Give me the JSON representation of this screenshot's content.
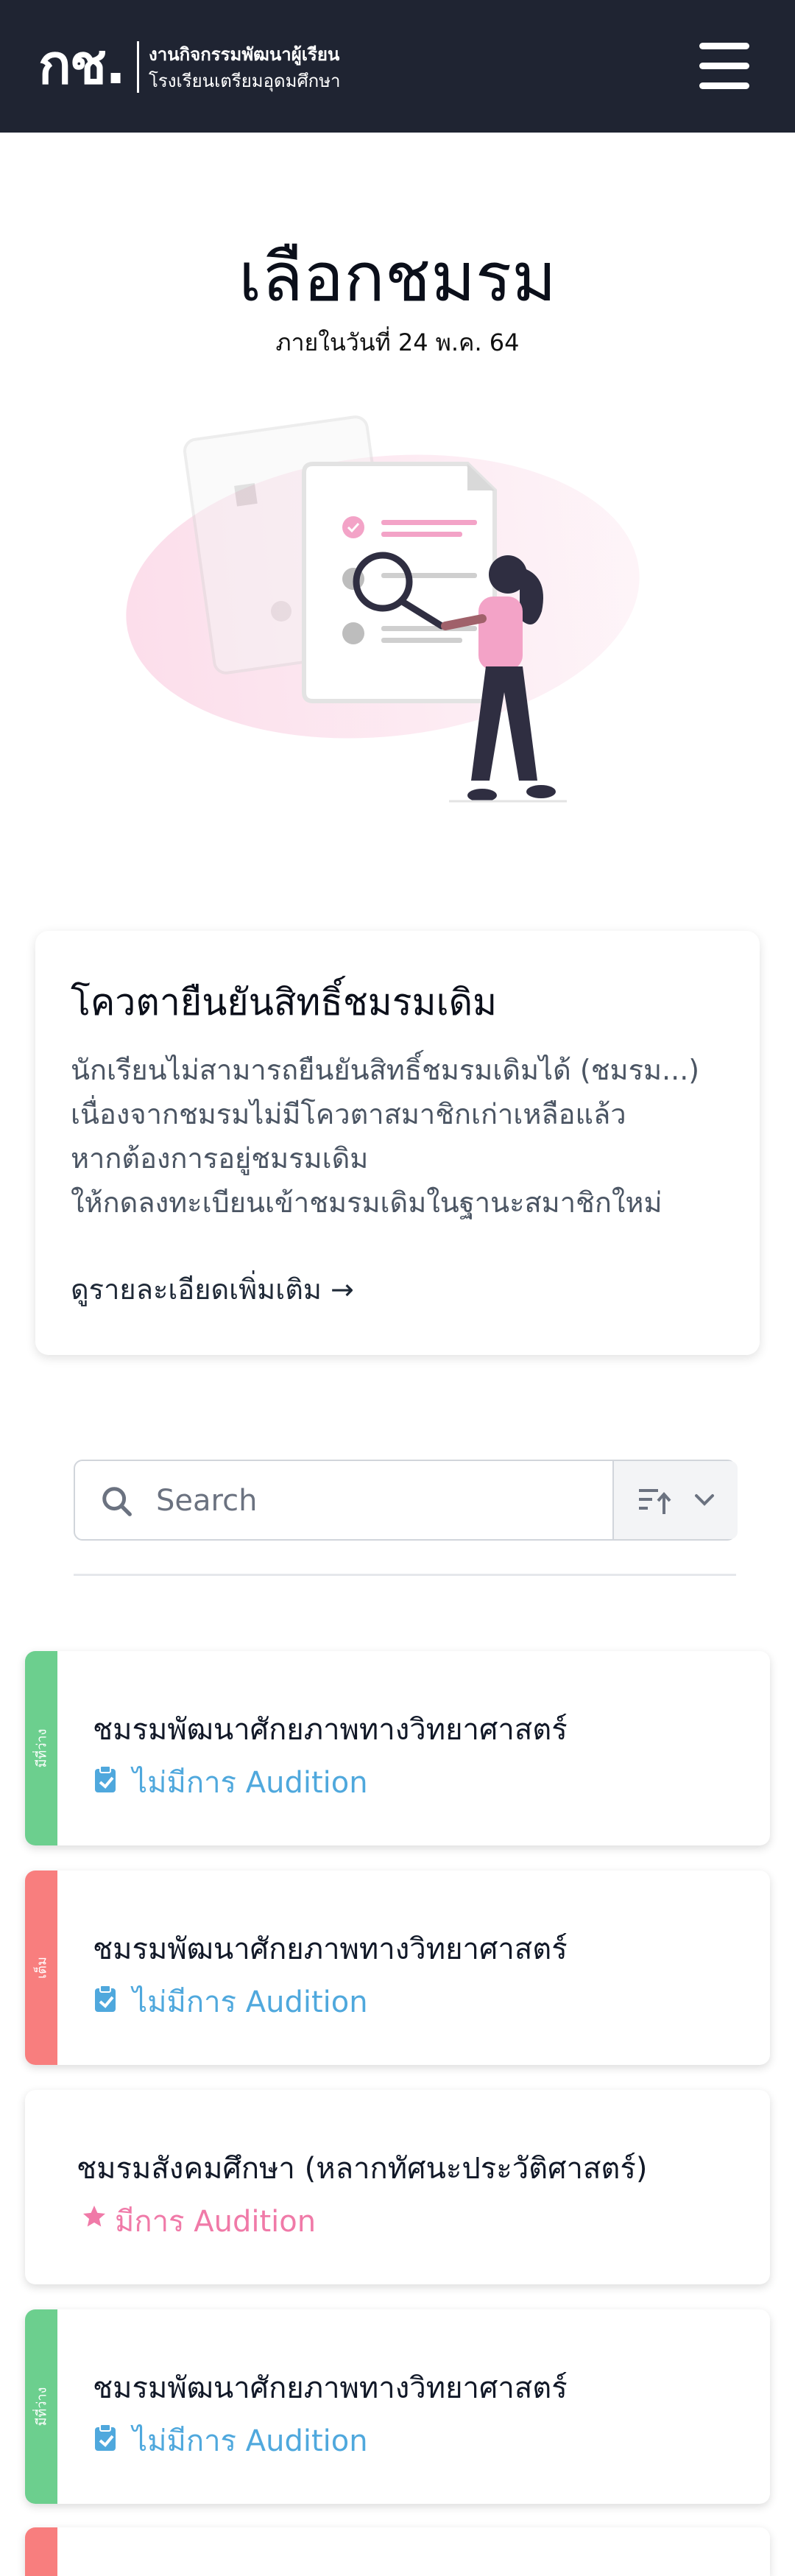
{
  "header": {
    "logo_mark": "กช.",
    "logo_line1": "งานกิจกรรมพัฒนาผู้เรียน",
    "logo_line2": "โรงเรียนเตรียมอุดมศึกษา"
  },
  "page": {
    "title": "เลือกชมรม",
    "subtitle": "ภายในวันที่ 24 พ.ค. 64"
  },
  "quota_card": {
    "title": "โควตายืนยันสิทธิ์ชมรมเดิม",
    "lines": [
      "นักเรียนไม่สามารถยืนยันสิทธิ์ชมรมเดิมได้ (ชมรม...)",
      "เนื่องจากชมรมไม่มีโควตาสมาชิกเก่าเหลือแล้ว",
      "หากต้องการอยู่ชมรมเดิม",
      "ให้กดลงทะเบียนเข้าชมรมเดิมในฐานะสมาชิกใหม่"
    ],
    "more_link": "ดูรายละเอียดเพิ่มเติม →"
  },
  "search": {
    "placeholder": "Search",
    "value": ""
  },
  "colors": {
    "header_bg": "#1f2432",
    "available": "#6ccf8e",
    "full": "#f87e7e",
    "no_audition": "#4fa8dd",
    "audition": "#f07aa8"
  },
  "clubs": [
    {
      "status": "มีที่ว่าง",
      "status_color": "#6ccf8e",
      "name": "ชมรมพัฒนาศักยภาพทางวิทยาศาสตร์",
      "audition": "ไม่มีการ Audition",
      "audition_icon": "clipboard-icon"
    },
    {
      "status": "เต็ม",
      "status_color": "#f87e7e",
      "name": "ชมรมพัฒนาศักยภาพทางวิทยาศาสตร์",
      "audition": "ไม่มีการ Audition",
      "audition_icon": "clipboard-icon"
    },
    {
      "status": "",
      "status_color": "",
      "name": "ชมรมสังคมศึกษา (หลากทัศนะประวัติศาสตร์)",
      "audition": "มีการ Audition",
      "audition_icon": "star-icon"
    },
    {
      "status": "มีที่ว่าง",
      "status_color": "#6ccf8e",
      "name": "ชมรมพัฒนาศักยภาพทางวิทยาศาสตร์",
      "audition": "ไม่มีการ Audition",
      "audition_icon": "clipboard-icon"
    },
    {
      "status": "",
      "status_color": "#f87e7e",
      "name": "",
      "audition": "",
      "audition_icon": ""
    }
  ]
}
